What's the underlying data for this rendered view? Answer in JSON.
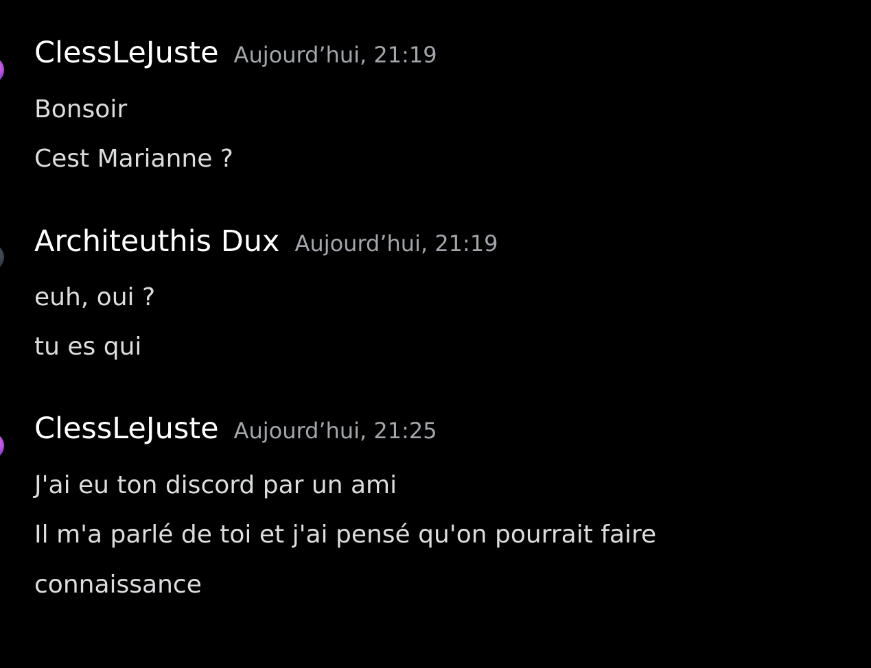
{
  "colors": {
    "background": "#000000",
    "username": "#ffffff",
    "timestamp": "#a3a6ab",
    "message": "#dcddde"
  },
  "messages": [
    {
      "author": "ClessLeJuste",
      "timestamp": "Aujourd’hui, 21:19",
      "avatar_icon": "user-avatar-icon",
      "lines": [
        "Bonsoir",
        "Cest Marianne ?"
      ]
    },
    {
      "author": "Architeuthis Dux",
      "timestamp": "Aujourd’hui, 21:19",
      "avatar_icon": "user-avatar-icon",
      "lines": [
        "euh, oui ?",
        "tu es qui"
      ]
    },
    {
      "author": "ClessLeJuste",
      "timestamp": "Aujourd’hui, 21:25",
      "avatar_icon": "user-avatar-icon",
      "lines": [
        "J'ai eu ton discord par un ami",
        "Il m'a parlé de toi et j'ai pensé qu'on pourrait faire",
        "connaissance"
      ]
    }
  ]
}
